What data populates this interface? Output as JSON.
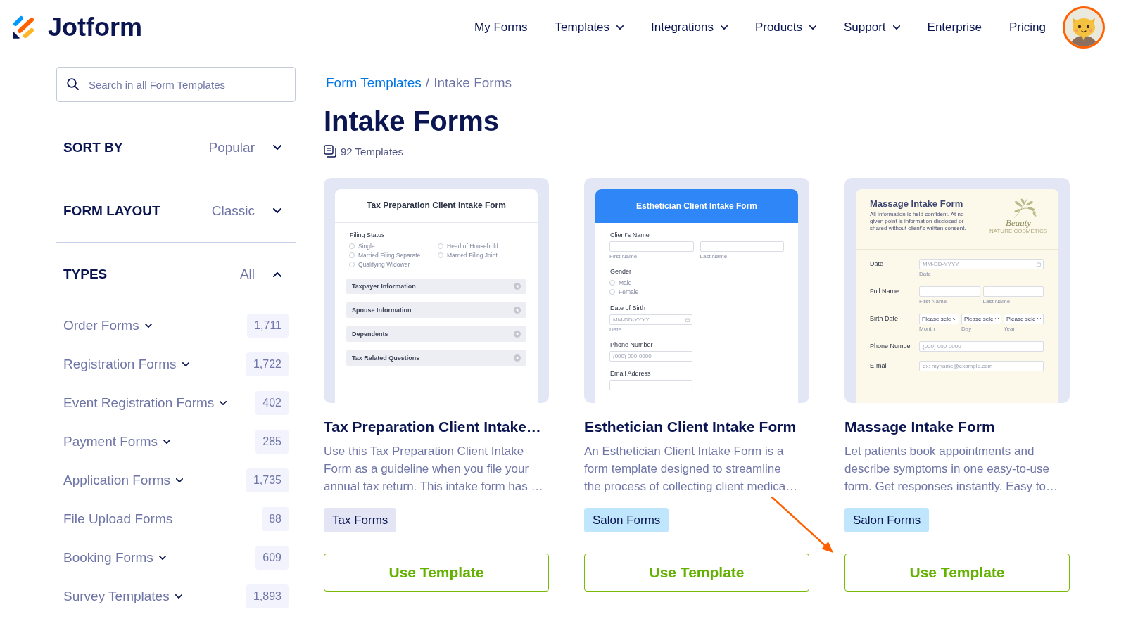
{
  "header": {
    "brand": "Jotform",
    "nav": [
      {
        "label": "My Forms",
        "dropdown": false
      },
      {
        "label": "Templates",
        "dropdown": true
      },
      {
        "label": "Integrations",
        "dropdown": true
      },
      {
        "label": "Products",
        "dropdown": true
      },
      {
        "label": "Support",
        "dropdown": true
      },
      {
        "label": "Enterprise",
        "dropdown": false
      },
      {
        "label": "Pricing",
        "dropdown": false
      }
    ]
  },
  "sidebar": {
    "search": {
      "placeholder": "Search in all Form Templates"
    },
    "filters": [
      {
        "label": "SORT BY",
        "value": "Popular",
        "expanded": false
      },
      {
        "label": "FORM LAYOUT",
        "value": "Classic",
        "expanded": false
      },
      {
        "label": "TYPES",
        "value": "All",
        "expanded": true
      }
    ],
    "types": [
      {
        "label": "Order Forms",
        "expandable": true,
        "count": "1,711"
      },
      {
        "label": "Registration Forms",
        "expandable": true,
        "count": "1,722"
      },
      {
        "label": "Event Registration Forms",
        "expandable": true,
        "count": "402"
      },
      {
        "label": "Payment Forms",
        "expandable": true,
        "count": "285"
      },
      {
        "label": "Application Forms",
        "expandable": true,
        "count": "1,735"
      },
      {
        "label": "File Upload Forms",
        "expandable": false,
        "count": "88"
      },
      {
        "label": "Booking Forms",
        "expandable": true,
        "count": "609"
      },
      {
        "label": "Survey Templates",
        "expandable": true,
        "count": "1,893"
      }
    ]
  },
  "main": {
    "breadcrumb": [
      {
        "kind": "link",
        "label": "Form Templates"
      },
      {
        "kind": "separator",
        "label": "/"
      },
      {
        "kind": "current",
        "label": "Intake Forms"
      }
    ],
    "title": "Intake Forms",
    "count": "92 Templates",
    "cards": [
      {
        "preview": {
          "kind": "plain",
          "title": "Tax Preparation Client Intake Form",
          "fields": [
            {
              "kind": "radio_grid",
              "label": "Filing Status",
              "options": [
                {
                  "label": "Single",
                  "selected": false
                },
                {
                  "label": "Head of Household",
                  "selected": false
                },
                {
                  "label": "Married Filing Separate",
                  "selected": false
                },
                {
                  "label": "Married Filing Joint",
                  "selected": false
                },
                {
                  "label": "Qualifying Widower",
                  "selected": false
                }
              ]
            },
            {
              "kind": "section",
              "label": "Taxpayer Information"
            },
            {
              "kind": "section",
              "label": "Spouse Information"
            },
            {
              "kind": "section",
              "label": "Dependents"
            },
            {
              "kind": "section",
              "label": "Tax Related Questions"
            }
          ]
        },
        "title": "Tax Preparation Client Intake…",
        "description": [
          "Use this Tax Preparation Client Intake",
          "Form as a guideline when you file your",
          "annual tax return. This intake form has …"
        ],
        "tag": {
          "label": "Tax Forms",
          "color": "#e3e5f5"
        },
        "button": "Use Template",
        "marked": false
      },
      {
        "preview": {
          "kind": "banner",
          "title": "Esthetician Client Intake Form",
          "fields": [
            {
              "kind": "name",
              "label": "Client's Name",
              "sublabels": [
                "First Name",
                "Last Name"
              ]
            },
            {
              "kind": "radio_list",
              "label": "Gender",
              "options": [
                {
                  "label": "Male",
                  "selected": false
                },
                {
                  "label": "Female",
                  "selected": false
                }
              ]
            },
            {
              "kind": "date",
              "label": "Date of Birth",
              "placeholder": "MM-DD-YYYY",
              "sublabel": "Date"
            },
            {
              "kind": "text",
              "label": "Phone Number",
              "placeholder": "(000) 000-0000"
            },
            {
              "kind": "text",
              "label": "Email Address"
            }
          ]
        },
        "title": "Esthetician Client Intake Form",
        "description": [
          "An Esthetician Client Intake Form is a",
          "form template designed to streamline",
          "the process of collecting client medica…"
        ],
        "tag": {
          "label": "Salon Forms",
          "color": "#bfe6fc"
        },
        "button": "Use Template",
        "marked": false
      },
      {
        "preview": {
          "kind": "logo",
          "title": "Massage Intake Form",
          "subtitle": "All information is held confident. At no given point is information disclosed or shared without client's written consent.",
          "logo": {
            "name": "Beauty",
            "tagline": "NATURE COSMETICS"
          },
          "fields": [
            {
              "kind": "date",
              "label": "Date",
              "placeholder": "MM-DD-YYYY",
              "sublabel": "Date"
            },
            {
              "kind": "name",
              "label": "Full Name",
              "sublabels": [
                "First Name",
                "Last Name"
              ]
            },
            {
              "kind": "select",
              "label": "Birth Date",
              "options": [
                {
                  "value": "Please sele",
                  "sublabel": "Month"
                },
                {
                  "value": "Please sele",
                  "sublabel": "Day"
                },
                {
                  "value": "Please sele",
                  "sublabel": "Year"
                }
              ]
            },
            {
              "kind": "text",
              "label": "Phone Number",
              "placeholder": "(000) 000-0000"
            },
            {
              "kind": "text",
              "label": "E-mail",
              "placeholder": "ex: myname@example.com"
            }
          ]
        },
        "title": "Massage Intake Form",
        "description": [
          "Let patients book appointments and",
          "describe symptoms in one easy-to-use",
          "form. Get responses instantly. Easy to…"
        ],
        "tag": {
          "label": "Salon Forms",
          "color": "#bfe6fc"
        },
        "button": "Use Template",
        "marked": true
      }
    ]
  }
}
